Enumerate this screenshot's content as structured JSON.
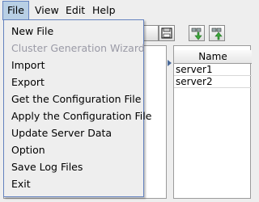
{
  "menubar": {
    "file": "File",
    "view": "View",
    "edit": "Edit",
    "help": "Help"
  },
  "toolbar": {
    "icons": [
      "save-icon",
      "download-icon",
      "upload-icon"
    ]
  },
  "table": {
    "column_header": "Name",
    "rows": [
      "server1",
      "server2"
    ]
  },
  "file_menu": {
    "items": [
      {
        "label": "New File",
        "enabled": true
      },
      {
        "label": "Cluster Generation Wizard",
        "enabled": false
      },
      {
        "label": "Import",
        "enabled": true
      },
      {
        "label": "Export",
        "enabled": true
      },
      {
        "label": "Get the Configuration File",
        "enabled": true
      },
      {
        "label": "Apply the Configuration File",
        "enabled": true
      },
      {
        "label": "Update Server Data",
        "enabled": true
      },
      {
        "label": "Option",
        "enabled": true
      },
      {
        "label": "Save Log Files",
        "enabled": true
      },
      {
        "label": "Exit",
        "enabled": true
      }
    ]
  }
}
